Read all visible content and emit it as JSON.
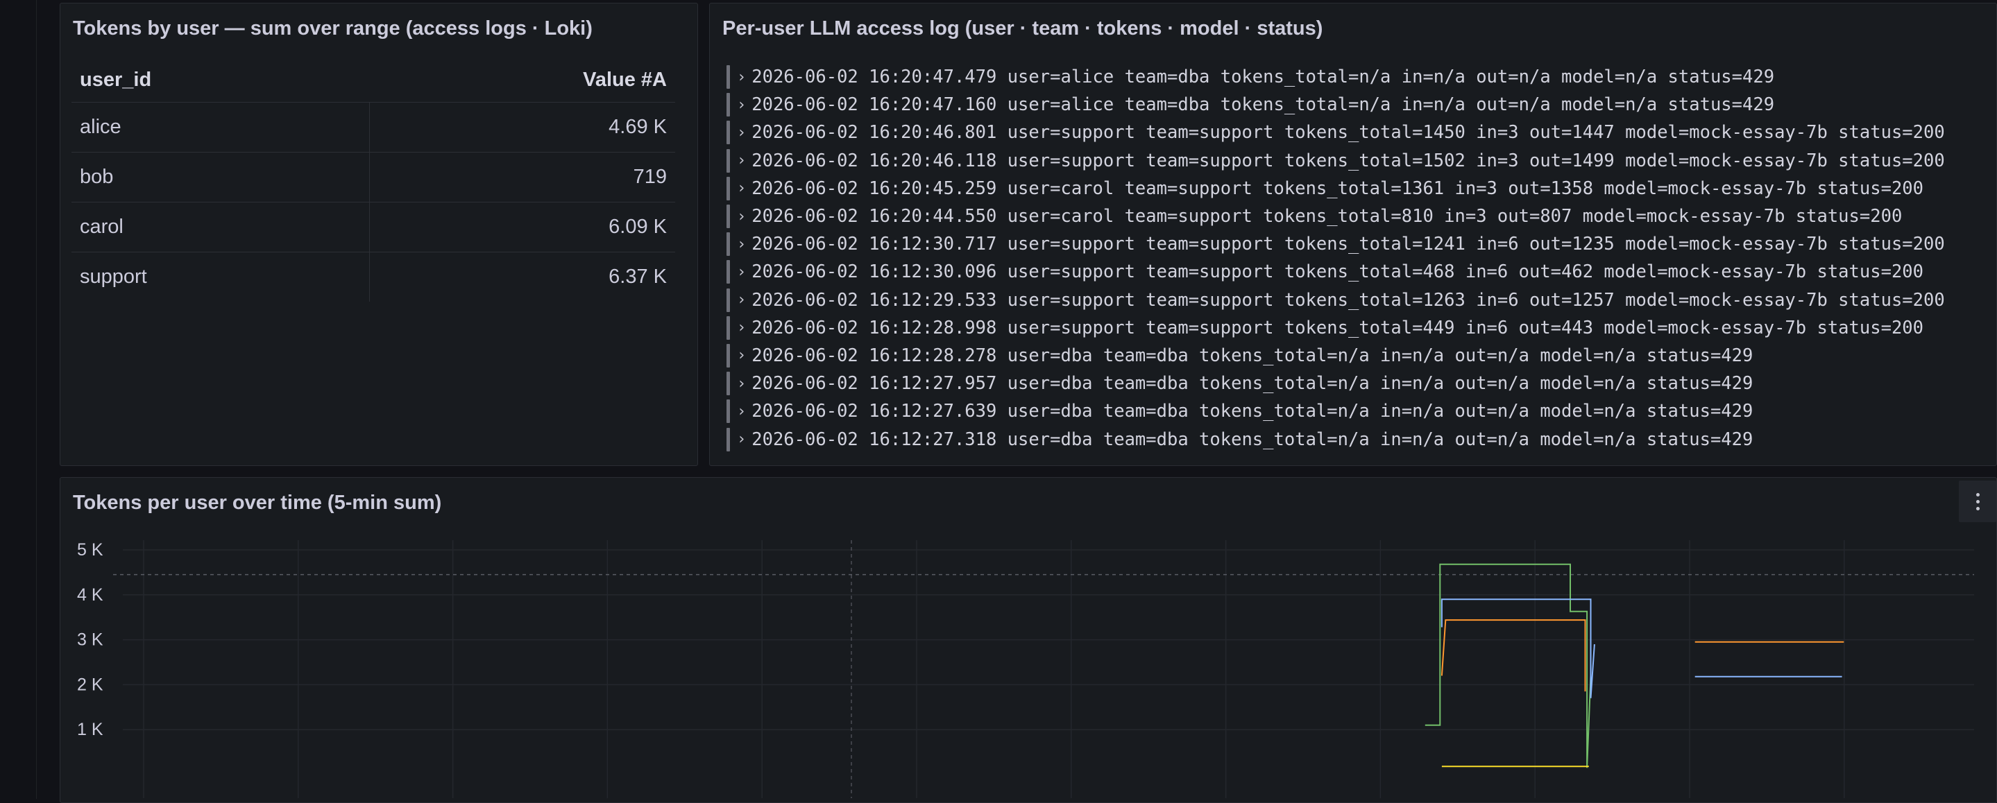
{
  "table_panel": {
    "title": "Tokens by user — sum over range (access logs · Loki)",
    "columns": [
      "user_id",
      "Value #A"
    ],
    "rows": [
      {
        "user": "alice",
        "value": "4.69 K"
      },
      {
        "user": "bob",
        "value": "719"
      },
      {
        "user": "carol",
        "value": "6.09 K"
      },
      {
        "user": "support",
        "value": "6.37 K"
      }
    ]
  },
  "log_panel": {
    "title": "Per-user LLM access log (user · team · tokens · model · status)",
    "lines": [
      "2026-06-02 16:20:47.479 user=alice team=dba tokens_total=n/a in=n/a out=n/a model=n/a status=429",
      "2026-06-02 16:20:47.160 user=alice team=dba tokens_total=n/a in=n/a out=n/a model=n/a status=429",
      "2026-06-02 16:20:46.801 user=support team=support tokens_total=1450 in=3 out=1447 model=mock-essay-7b status=200",
      "2026-06-02 16:20:46.118 user=support team=support tokens_total=1502 in=3 out=1499 model=mock-essay-7b status=200",
      "2026-06-02 16:20:45.259 user=carol team=support tokens_total=1361 in=3 out=1358 model=mock-essay-7b status=200",
      "2026-06-02 16:20:44.550 user=carol team=support tokens_total=810 in=3 out=807 model=mock-essay-7b status=200",
      "2026-06-02 16:12:30.717 user=support team=support tokens_total=1241 in=6 out=1235 model=mock-essay-7b status=200",
      "2026-06-02 16:12:30.096 user=support team=support tokens_total=468 in=6 out=462 model=mock-essay-7b status=200",
      "2026-06-02 16:12:29.533 user=support team=support tokens_total=1263 in=6 out=1257 model=mock-essay-7b status=200",
      "2026-06-02 16:12:28.998 user=support team=support tokens_total=449 in=6 out=443 model=mock-essay-7b status=200",
      "2026-06-02 16:12:28.278 user=dba team=dba tokens_total=n/a in=n/a out=n/a model=n/a status=429",
      "2026-06-02 16:12:27.957 user=dba team=dba tokens_total=n/a in=n/a out=n/a model=n/a status=429",
      "2026-06-02 16:12:27.639 user=dba team=dba tokens_total=n/a in=n/a out=n/a model=n/a status=429",
      "2026-06-02 16:12:27.318 user=dba team=dba tokens_total=n/a in=n/a out=n/a model=n/a status=429"
    ]
  },
  "chart_panel": {
    "title": "Tokens per user over time (5-min sum)",
    "menu_icon": "kebab-menu-icon"
  },
  "chart_data": {
    "type": "line",
    "title": "Tokens per user over time (5-min sum)",
    "ylim": [
      0,
      5400
    ],
    "xlim": [
      0,
      100
    ],
    "yticks": [
      {
        "value": 5000,
        "label": "5 K"
      },
      {
        "value": 4000,
        "label": "4 K"
      },
      {
        "value": 3000,
        "label": "3 K"
      },
      {
        "value": 2000,
        "label": "2 K"
      },
      {
        "value": 1000,
        "label": "1 K"
      }
    ],
    "threshold": 4450,
    "grid": true,
    "series": [
      {
        "color": "#73bf69",
        "points": [
          [
            70.5,
            1100
          ],
          [
            71.3,
            1100
          ],
          [
            71.3,
            4680
          ],
          [
            78.3,
            4680
          ],
          [
            78.3,
            3630
          ],
          [
            79.2,
            3630
          ],
          [
            79.2,
            150
          ],
          [
            79.4,
            2200
          ]
        ]
      },
      {
        "color": "#8ab8ff",
        "points": [
          [
            71.4,
            3280
          ],
          [
            71.4,
            3900
          ],
          [
            79.4,
            3900
          ],
          [
            79.4,
            1700
          ],
          [
            79.6,
            2900
          ]
        ]
      },
      {
        "color": "#ff9830",
        "points": [
          [
            71.4,
            2200
          ],
          [
            71.6,
            3440
          ],
          [
            79.1,
            3440
          ],
          [
            79.1,
            1850
          ]
        ]
      },
      {
        "color": "#fade2a",
        "points": [
          [
            71.4,
            180
          ],
          [
            79.3,
            180
          ]
        ]
      },
      {
        "color": "#ff9830",
        "points": [
          [
            85.0,
            2950
          ],
          [
            93.0,
            2950
          ]
        ]
      },
      {
        "color": "#8ab8ff",
        "points": [
          [
            85.0,
            2180
          ],
          [
            92.9,
            2180
          ]
        ]
      }
    ]
  }
}
